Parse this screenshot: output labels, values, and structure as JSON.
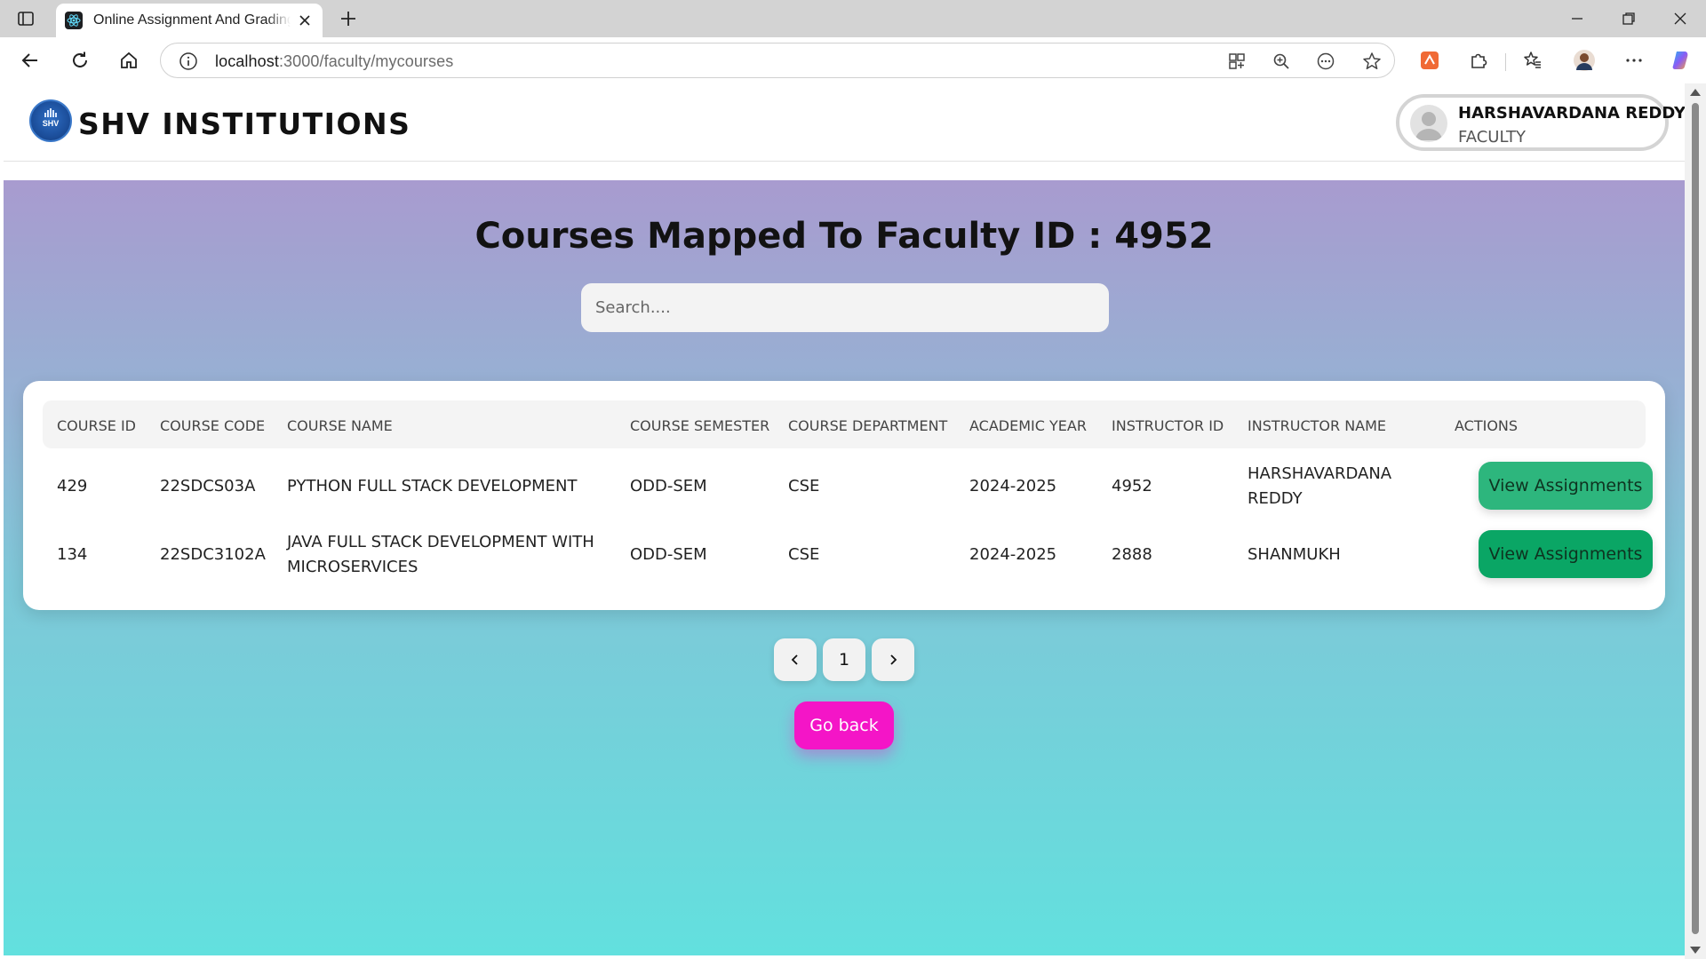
{
  "browser": {
    "tab_title": "Online Assignment And Grading System",
    "url_host": "localhost",
    "url_rest": ":3000/faculty/mycourses"
  },
  "header": {
    "brand": "SHV INSTITUTIONS",
    "logo_text": "SHV",
    "user_name": "HARSHAVARDANA REDDY",
    "user_role": "FACULTY"
  },
  "main": {
    "heading": "Courses Mapped To Faculty ID : 4952",
    "search_placeholder": "Search...."
  },
  "table": {
    "columns": [
      "COURSE ID",
      "COURSE CODE",
      "COURSE NAME",
      "COURSE SEMESTER",
      "COURSE DEPARTMENT",
      "ACADEMIC YEAR",
      "INSTRUCTOR ID",
      "INSTRUCTOR NAME",
      "ACTIONS"
    ],
    "rows": [
      {
        "course_id": "429",
        "course_code": "22SDCS03A",
        "course_name": "PYTHON FULL STACK DEVELOPMENT",
        "semester": "ODD-SEM",
        "department": "CSE",
        "academic_year": "2024-2025",
        "instructor_id": "4952",
        "instructor_name": "HARSHAVARDANA REDDY",
        "action_label": "View Assignments"
      },
      {
        "course_id": "134",
        "course_code": "22SDC3102A",
        "course_name": "JAVA FULL STACK DEVELOPMENT WITH MICROSERVICES",
        "semester": "ODD-SEM",
        "department": "CSE",
        "academic_year": "2024-2025",
        "instructor_id": "2888",
        "instructor_name": "SHANMUKH",
        "action_label": "View Assignments"
      }
    ]
  },
  "pagination": {
    "current_page": "1"
  },
  "actions": {
    "go_back_label": "Go back"
  },
  "colors": {
    "accent_pink": "#f415c7",
    "green_button": "#0aa665",
    "gradient_top": "#a89bcf",
    "gradient_bottom": "#62e0de"
  }
}
